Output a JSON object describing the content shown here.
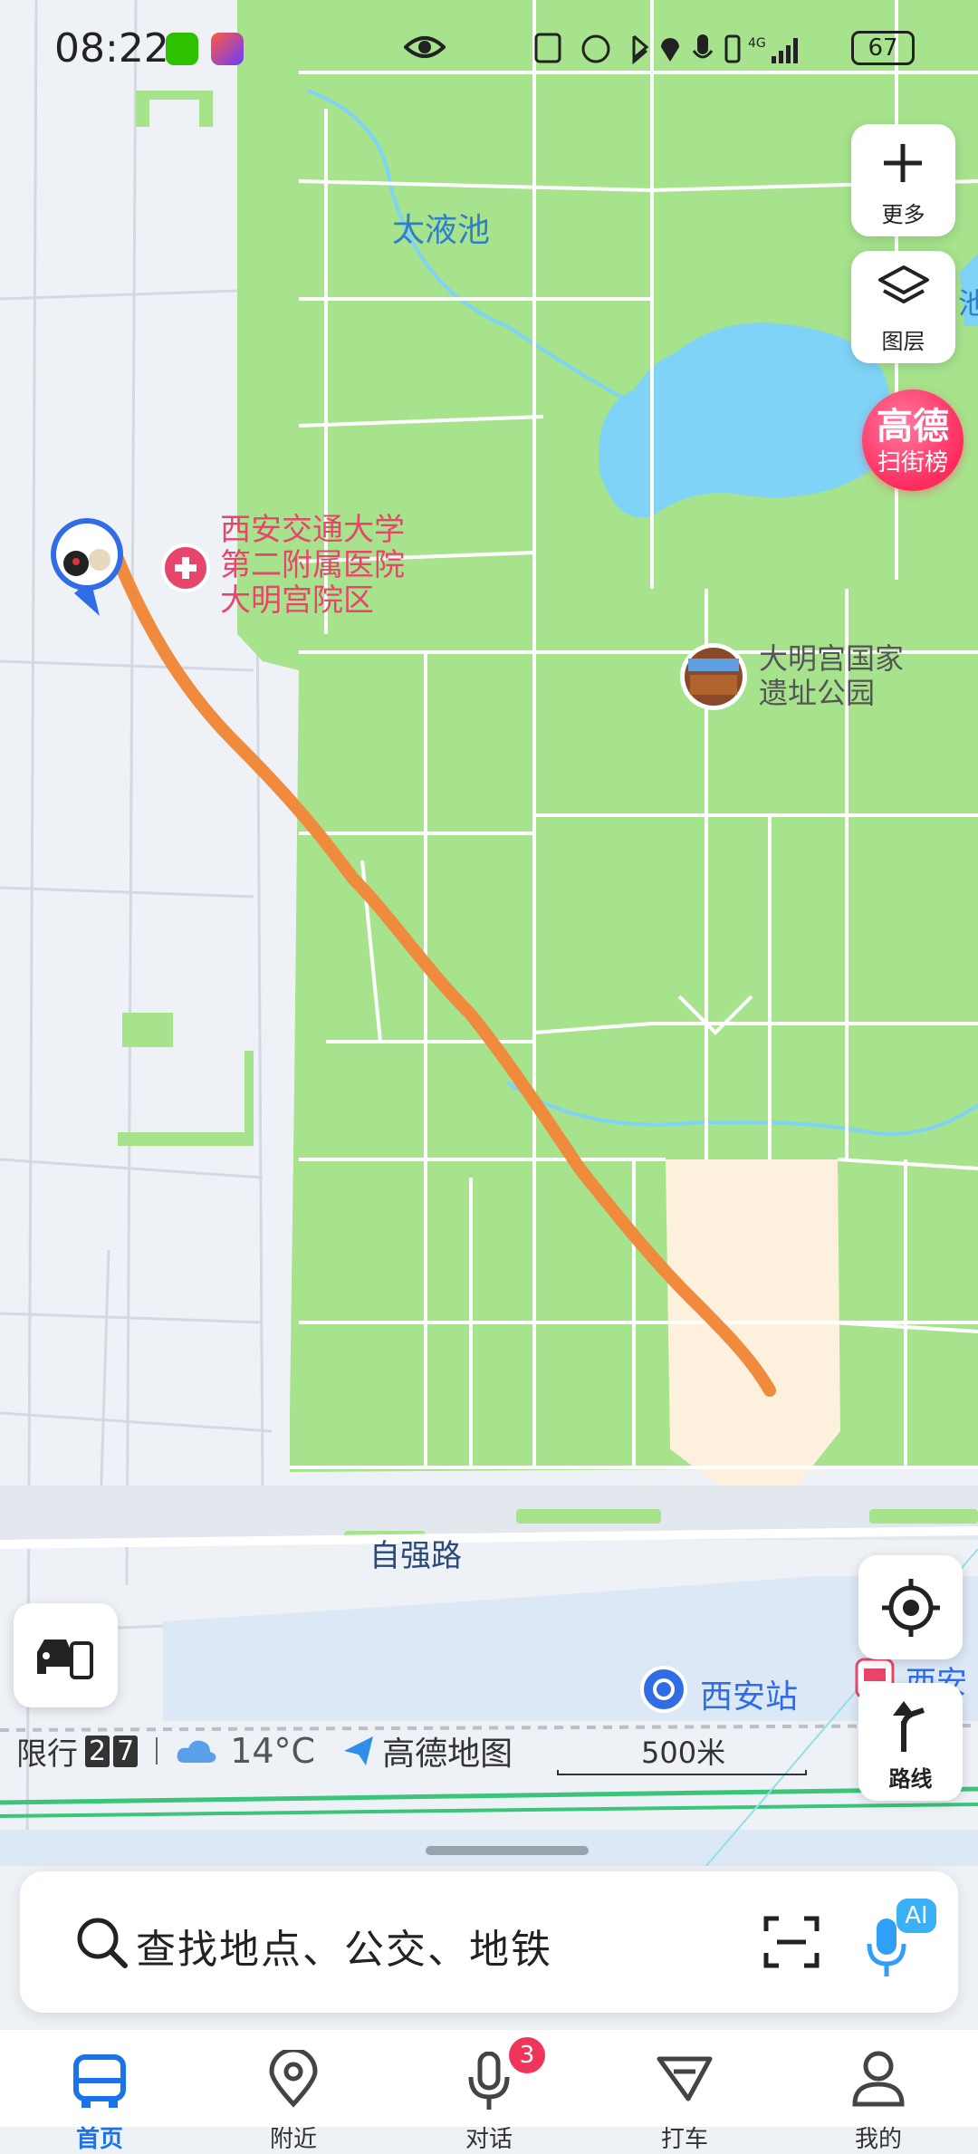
{
  "status_bar": {
    "time": "08:22",
    "battery": "67"
  },
  "map_controls": {
    "more_label": "更多",
    "layers_label": "图层"
  },
  "rank_badge": {
    "line1": "高德",
    "line2": "扫街榜"
  },
  "map_labels": {
    "lake": "太液池",
    "lake_right": "池",
    "hospital_l1": "西安交通大学",
    "hospital_l2": "第二附属医院",
    "hospital_l3": "大明宫院区",
    "park_l1": "大明宫国家",
    "park_l2": "遗址公园",
    "road": "自强路",
    "station": "西安站",
    "station_right": "西安"
  },
  "info_strip": {
    "restriction_label": "限行",
    "restriction_digits": [
      "2",
      "7"
    ],
    "temperature": "14°C",
    "brand": "高德地图",
    "scale": "500米"
  },
  "route_button": {
    "label": "路线"
  },
  "search": {
    "placeholder": "查找地点、公交、地铁",
    "ai_label": "AI"
  },
  "tabs": [
    {
      "label": "首页",
      "active": true
    },
    {
      "label": "附近",
      "active": false
    },
    {
      "label": "对话",
      "active": false,
      "badge": "3"
    },
    {
      "label": "打车",
      "active": false
    },
    {
      "label": "我的",
      "active": false
    }
  ],
  "colors": {
    "accent": "#1a73e8",
    "route": "#f08a3c",
    "badge": "#ff2b5e",
    "park": "#a6e38c",
    "water": "#7fd3f7"
  }
}
